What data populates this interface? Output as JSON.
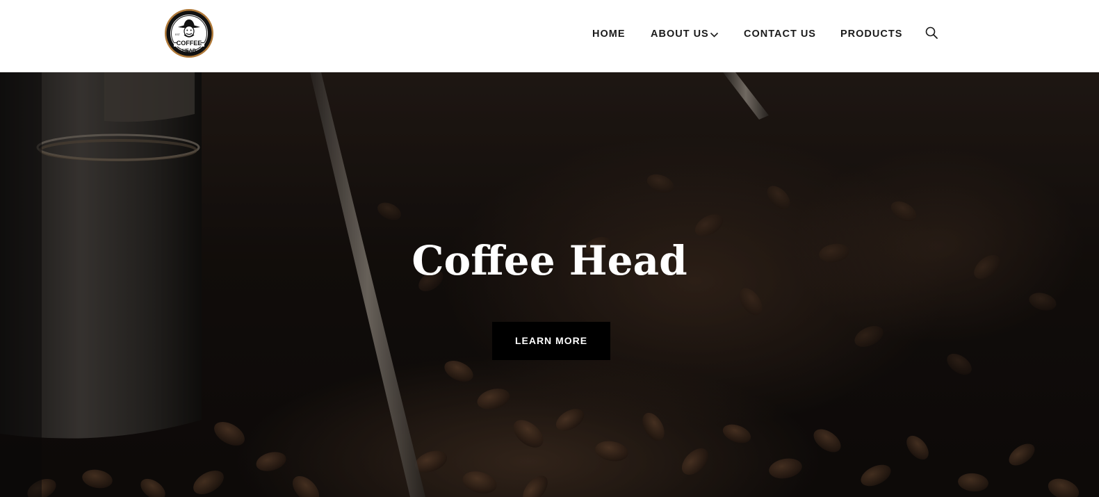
{
  "brand": {
    "logo_text_main": "COFFEE",
    "logo_text_sub": "HEAD",
    "logo_est": "EST",
    "logo_arc": "HIGH GROWN COFFEE ROASTER"
  },
  "nav": {
    "items": [
      {
        "label": "HOME"
      },
      {
        "label": "ABOUT US",
        "has_dropdown": true
      },
      {
        "label": "CONTACT US"
      },
      {
        "label": "PRODUCTS"
      }
    ],
    "search_icon": "search-icon"
  },
  "hero": {
    "title": "Coffee Head",
    "cta_label": "LEARN MORE",
    "background": "coffee beans in roaster (photo)"
  },
  "colors": {
    "header_bg": "#ffffff",
    "nav_text": "#1a1a1a",
    "cta_bg": "#000000",
    "cta_text": "#ffffff",
    "hero_title": "#ffffff",
    "logo_ring": "#b07a3a"
  }
}
